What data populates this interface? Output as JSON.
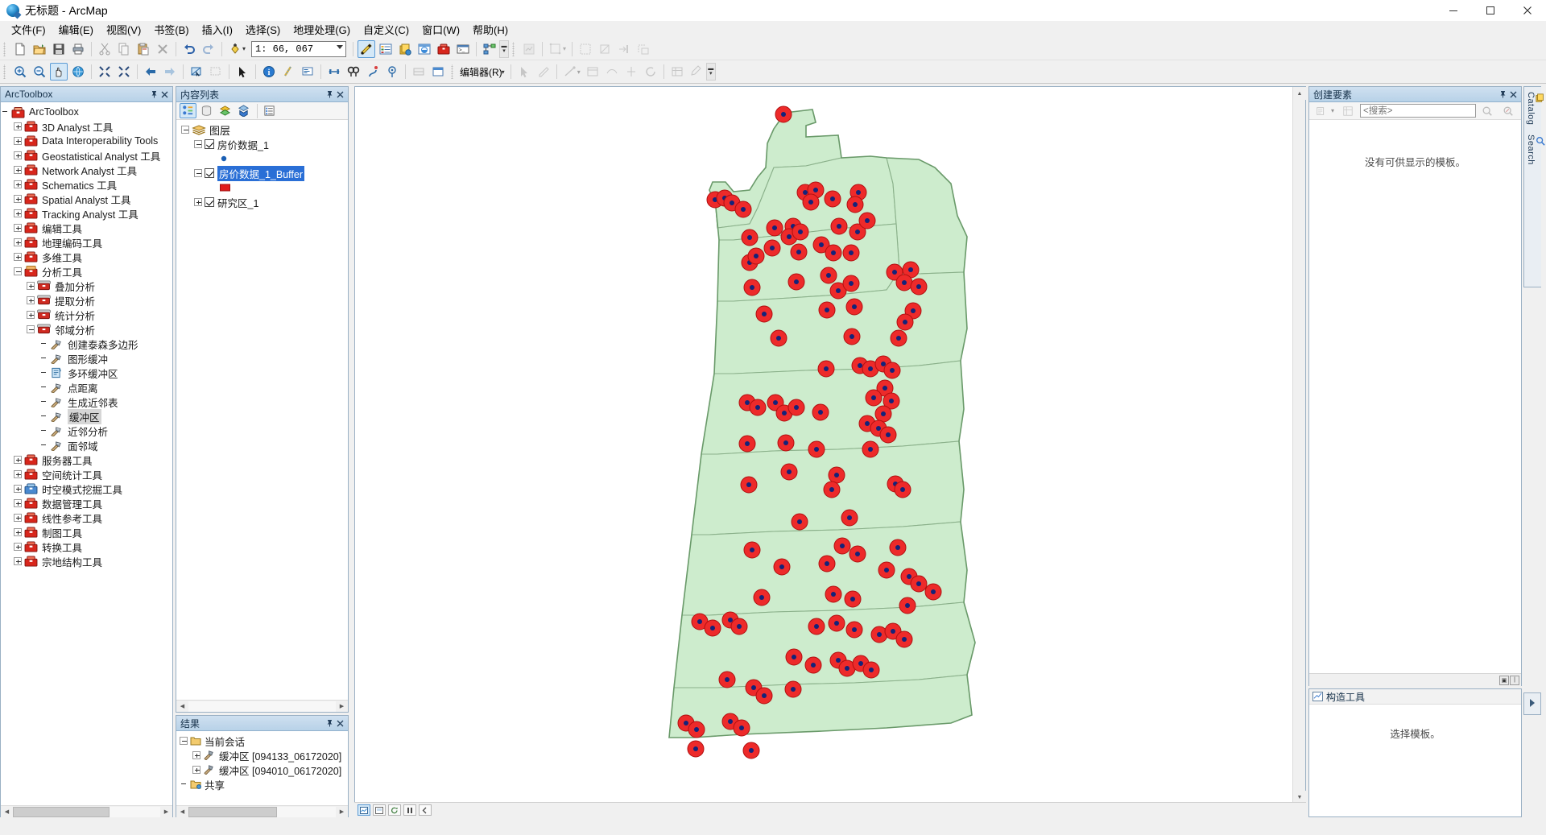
{
  "window": {
    "title": "无标题 - ArcMap",
    "app_icon": "arcmap-globe-icon",
    "minimize": "−",
    "maximize": "▢",
    "close": "✕"
  },
  "menubar": {
    "items": [
      {
        "label": "文件(F)",
        "name": "menu-file"
      },
      {
        "label": "编辑(E)",
        "name": "menu-edit"
      },
      {
        "label": "视图(V)",
        "name": "menu-view"
      },
      {
        "label": "书签(B)",
        "name": "menu-bookmarks"
      },
      {
        "label": "插入(I)",
        "name": "menu-insert"
      },
      {
        "label": "选择(S)",
        "name": "menu-selection"
      },
      {
        "label": "地理处理(G)",
        "name": "menu-geoprocessing"
      },
      {
        "label": "自定义(C)",
        "name": "menu-customize"
      },
      {
        "label": "窗口(W)",
        "name": "menu-windows"
      },
      {
        "label": "帮助(H)",
        "name": "menu-help"
      }
    ]
  },
  "toolbar_standard": {
    "scale_value": "1: 66, 067",
    "scale_placeholder": "1: 66, 067",
    "editor_label": "编辑器(R)",
    "buttons": [
      "new-document-icon",
      "open-document-icon",
      "save-icon",
      "print-icon",
      "cut-icon",
      "copy-icon",
      "paste-icon",
      "delete-icon",
      "undo-icon",
      "redo-icon",
      "add-data-icon"
    ],
    "buttons_right": [
      "editor-toolbar-icon",
      "table-of-contents-icon",
      "catalog-icon",
      "search-window-icon",
      "arctoolbox-icon",
      "python-window-icon",
      "model-builder-icon"
    ]
  },
  "toolbar_tools": {
    "buttons": [
      "zoom-in-icon",
      "zoom-out-icon",
      "pan-icon",
      "full-extent-icon",
      "fixed-zoom-in-icon",
      "fixed-zoom-out-icon",
      "go-back-extent-icon",
      "go-next-extent-icon",
      "select-features-icon",
      "clear-selection-icon",
      "select-elements-icon",
      "identify-icon",
      "hyperlink-icon",
      "html-popup-icon",
      "measure-icon",
      "find-icon",
      "find-route-icon",
      "xy-location-icon",
      "time-slider-icon",
      "create-viewer-window-icon"
    ]
  },
  "arctoolbox": {
    "panel_title": "ArcToolbox",
    "pin": "⊞",
    "close": "✕",
    "root": {
      "label": "ArcToolbox",
      "icon": "arctoolbox-root-icon"
    },
    "items": [
      {
        "label": "3D Analyst 工具",
        "icon": "toolbox-icon",
        "indent": 1,
        "expander": "plus"
      },
      {
        "label": "Data Interoperability Tools",
        "icon": "toolbox-icon",
        "indent": 1,
        "expander": "plus"
      },
      {
        "label": "Geostatistical Analyst 工具",
        "icon": "toolbox-icon",
        "indent": 1,
        "expander": "plus"
      },
      {
        "label": "Network Analyst 工具",
        "icon": "toolbox-icon",
        "indent": 1,
        "expander": "plus"
      },
      {
        "label": "Schematics 工具",
        "icon": "toolbox-icon",
        "indent": 1,
        "expander": "plus"
      },
      {
        "label": "Spatial Analyst 工具",
        "icon": "toolbox-icon",
        "indent": 1,
        "expander": "plus"
      },
      {
        "label": "Tracking Analyst 工具",
        "icon": "toolbox-icon",
        "indent": 1,
        "expander": "plus"
      },
      {
        "label": "编辑工具",
        "icon": "toolbox-icon",
        "indent": 1,
        "expander": "plus"
      },
      {
        "label": "地理编码工具",
        "icon": "toolbox-icon",
        "indent": 1,
        "expander": "plus"
      },
      {
        "label": "多维工具",
        "icon": "toolbox-icon",
        "indent": 1,
        "expander": "plus"
      },
      {
        "label": "分析工具",
        "icon": "toolbox-open-icon",
        "indent": 1,
        "expander": "minus"
      },
      {
        "label": "叠加分析",
        "icon": "toolset-icon",
        "indent": 2,
        "expander": "plus"
      },
      {
        "label": "提取分析",
        "icon": "toolset-icon",
        "indent": 2,
        "expander": "plus"
      },
      {
        "label": "统计分析",
        "icon": "toolset-icon",
        "indent": 2,
        "expander": "plus"
      },
      {
        "label": "邻域分析",
        "icon": "toolset-icon",
        "indent": 2,
        "expander": "minus"
      },
      {
        "label": "创建泰森多边形",
        "icon": "hammer-tool-icon",
        "indent": 3,
        "expander": "none"
      },
      {
        "label": "图形缓冲",
        "icon": "hammer-tool-icon",
        "indent": 3,
        "expander": "none"
      },
      {
        "label": "多环缓冲区",
        "icon": "script-tool-icon",
        "indent": 3,
        "expander": "none"
      },
      {
        "label": "点距离",
        "icon": "hammer-tool-icon",
        "indent": 3,
        "expander": "none"
      },
      {
        "label": "生成近邻表",
        "icon": "hammer-tool-icon",
        "indent": 3,
        "expander": "none"
      },
      {
        "label": "缓冲区",
        "icon": "hammer-tool-icon",
        "indent": 3,
        "expander": "none",
        "selected": true
      },
      {
        "label": "近邻分析",
        "icon": "hammer-tool-icon",
        "indent": 3,
        "expander": "none"
      },
      {
        "label": "面邻域",
        "icon": "hammer-tool-icon",
        "indent": 3,
        "expander": "none"
      },
      {
        "label": "服务器工具",
        "icon": "toolbox-icon",
        "indent": 1,
        "expander": "plus"
      },
      {
        "label": "空间统计工具",
        "icon": "toolbox-icon",
        "indent": 1,
        "expander": "plus"
      },
      {
        "label": "时空模式挖掘工具",
        "icon": "script-toolbox-icon",
        "indent": 1,
        "expander": "plus"
      },
      {
        "label": "数据管理工具",
        "icon": "toolbox-icon",
        "indent": 1,
        "expander": "plus"
      },
      {
        "label": "线性参考工具",
        "icon": "toolbox-icon",
        "indent": 1,
        "expander": "plus"
      },
      {
        "label": "制图工具",
        "icon": "toolbox-icon",
        "indent": 1,
        "expander": "plus"
      },
      {
        "label": "转换工具",
        "icon": "toolbox-icon",
        "indent": 1,
        "expander": "plus"
      },
      {
        "label": "宗地结构工具",
        "icon": "toolbox-icon",
        "indent": 1,
        "expander": "plus"
      }
    ]
  },
  "toc": {
    "panel_title": "内容列表",
    "pin": "⊞",
    "close": "✕",
    "toolbar_buttons": [
      "list-by-drawing-order-icon",
      "list-by-source-icon",
      "list-by-visibility-icon",
      "list-by-selection-icon",
      "options-icon"
    ],
    "root_label": "图层",
    "layers": [
      {
        "label": "房价数据_1",
        "checked": true,
        "selected": false,
        "symbol": "point",
        "symbol_color": "#1a5fb4"
      },
      {
        "label": "房价数据_1_Buffer",
        "checked": true,
        "selected": true,
        "symbol": "polygon",
        "symbol_color": "#e01b1b"
      },
      {
        "label": "研究区_1",
        "checked": true,
        "selected": false,
        "symbol": null,
        "collapsed": true
      }
    ]
  },
  "results": {
    "panel_title": "结果",
    "pin": "⊞",
    "close": "✕",
    "session_label": "当前会话",
    "items": [
      {
        "label": "缓冲区 [094133_06172020]",
        "icon": "tool-result-icon"
      },
      {
        "label": "缓冲区 [094010_06172020]",
        "icon": "tool-result-icon"
      }
    ],
    "shared_label": "共享"
  },
  "create_features": {
    "panel_title": "创建要素",
    "pin": "⊞",
    "close": "✕",
    "search_placeholder": "<搜索>",
    "empty_message": "没有可供显示的模板。",
    "toolbar_buttons": [
      "new-template-icon",
      "organize-templates-icon",
      "search-go-icon",
      "clear-search-icon"
    ]
  },
  "construction_tools": {
    "panel_title": "构造工具",
    "empty_message": "选择模板。",
    "icon": "construction-tools-icon"
  },
  "right_tabs": [
    {
      "label": "Catalog",
      "name": "tab-catalog"
    },
    {
      "label": "Search",
      "name": "tab-search"
    }
  ],
  "map_status": {
    "buttons": [
      "data-view-icon",
      "layout-view-icon",
      "refresh-icon",
      "pause-icon",
      "continue-icon"
    ]
  },
  "colors": {
    "polygon_fill": "#cdeccd",
    "polygon_stroke": "#7faf7f",
    "buffer_fill": "#ed2a2a",
    "point_fill": "#1a3a8f",
    "selection_blue": "#2a6fd6",
    "panel_header": "#b8d2e8"
  }
}
